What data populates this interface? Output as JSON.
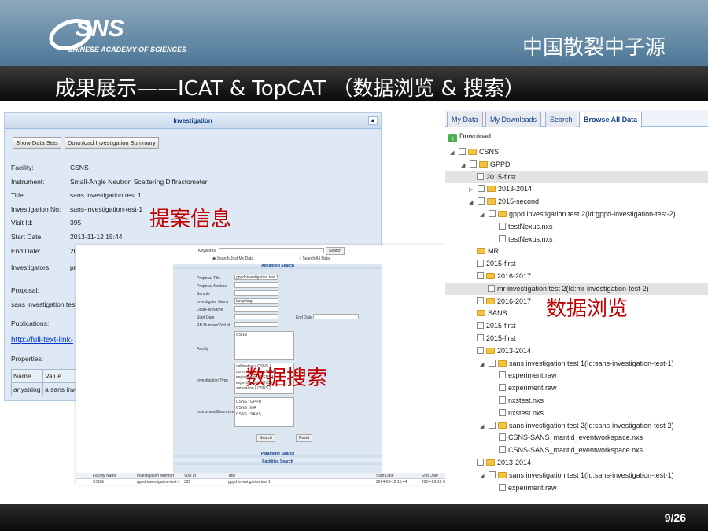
{
  "header": {
    "logo_text": "SNS",
    "logo_sub": "CHINESE ACADEMY OF SCIENCES",
    "org_name": "中国散裂中子源",
    "slide_title": "成果展示——ICAT & TopCAT （数据浏览 & 搜索）"
  },
  "footer": {
    "page": "9/26"
  },
  "labels": {
    "proposal_info": "提案信息",
    "data_search": "数据搜索",
    "data_browse": "数据浏览"
  },
  "investigation": {
    "panel_title": "Investigation",
    "show_data_sets": "Show Data Sets",
    "download_summary": "Download Investigation Summary",
    "fields": [
      {
        "k": "Facility:",
        "v": "CSNS"
      },
      {
        "k": "Instrument:",
        "v": "Small-Angle Neutron Scattering Diffractometer"
      },
      {
        "k": "Title:",
        "v": "sans investigation test 1"
      },
      {
        "k": "Investigation No:",
        "v": "sans-investigation-test-1"
      },
      {
        "k": "Visit Id:",
        "v": "395"
      },
      {
        "k": "Start Date:",
        "v": "2013-11-12 15:44"
      },
      {
        "k": "End Date:",
        "v": "20"
      },
      {
        "k": "Investigators:",
        "v": "pr"
      }
    ],
    "proposal_label": "Proposal:",
    "proposal_value": "sans investigation test",
    "publications_label": "Publications:",
    "publication_link": "http://full-text-link-",
    "properties_label": "Properties:",
    "properties_headers": [
      "Name",
      "Value"
    ],
    "properties_row": [
      "anystring",
      "a sans inve"
    ]
  },
  "search": {
    "keywords_label": "Keywords",
    "search_btn": "Search",
    "radio_my": "Search Just My Data",
    "radio_all": "Search All Data",
    "advanced_title": "Advanced Search",
    "proposal_title_label": "Proposal Title",
    "proposal_title_value": "gppd investigation test 1",
    "proposal_abstract_label": "Proposal Abstract",
    "sample_label": "Sample",
    "investigator_label": "Investigator Name",
    "investigator_value": "tangming",
    "datafile_label": "DataFile Name",
    "start_date_label": "Start Date",
    "end_date_label": "End Date",
    "rb_label": "RB Number/Visit Id",
    "facility_label": "Facility",
    "facility_value": "CSNS",
    "inv_type_label": "Investigation Type",
    "inv_types": [
      "calibration ( CSNS )",
      "commissioning ( CSNS )",
      "engineering ( CSNS )",
      "experiment ( CSNS )",
      "simulation ( CSNS )"
    ],
    "instrument_label": "Instrument/Beam Line",
    "instruments": [
      "CSNS : GPPD",
      "CSNS : MR",
      "CSNS : SANS"
    ],
    "search_btn2": "Search",
    "reset_btn": "Reset",
    "param_title": "Parameter Search",
    "facilities_title": "Facilities Search",
    "results_headers": [
      "Facility Name",
      "Investigation Number",
      "Visit Id",
      "Title",
      "Start Date",
      "End Date"
    ],
    "results_row": [
      "CSNS",
      "gppd-investigation-test-1",
      "395",
      "gppd investigation test 1",
      "2014-03-12 15:44",
      "2014-03-15 00:00"
    ]
  },
  "tree": {
    "tabs": [
      "My Data",
      "My Downloads",
      "Search",
      "Browse All Data"
    ],
    "download": "Download",
    "items": [
      {
        "label": "CSNS",
        "folder": true
      },
      {
        "label": "GPPD",
        "folder": true
      },
      {
        "label": "2015-first",
        "folder": false
      },
      {
        "label": "2013-2014",
        "folder": true
      },
      {
        "label": "2015-second",
        "folder": true
      },
      {
        "label": "gppd investigation test 2(Id:gppd-investigation-test-2)",
        "folder": true
      },
      {
        "label": "testNexus.nxs",
        "folder": false
      },
      {
        "label": "testNexus.nxs",
        "folder": false
      },
      {
        "label": "MR",
        "folder": true
      },
      {
        "label": "2015-first",
        "folder": false
      },
      {
        "label": "2016-2017",
        "folder": true
      },
      {
        "label": "mr investigation test 2(Id:mr-investigation-test-2)",
        "folder": false
      },
      {
        "label": "2016-2017",
        "folder": true
      },
      {
        "label": "SANS",
        "folder": true
      },
      {
        "label": "2015-first",
        "folder": false
      },
      {
        "label": "2015-first",
        "folder": false
      },
      {
        "label": "2013-2014",
        "folder": true
      },
      {
        "label": "sans investigation test 1(Id:sans-investigation-test-1)",
        "folder": true
      },
      {
        "label": "experiment.raw",
        "folder": false
      },
      {
        "label": "experiment.raw",
        "folder": false
      },
      {
        "label": "nxstest.nxs",
        "folder": false
      },
      {
        "label": "nxstest.nxs",
        "folder": false
      },
      {
        "label": "sans investigation test 2(Id:sans-investigation-test-2)",
        "folder": true
      },
      {
        "label": "CSNS-SANS_mantid_eventworkspace.nxs",
        "folder": false
      },
      {
        "label": "CSNS-SANS_mantid_eventworkspace.nxs",
        "folder": false
      },
      {
        "label": "2013-2014",
        "folder": true
      },
      {
        "label": "sans investigation test 1(Id:sans-investigation-test-1)",
        "folder": true
      },
      {
        "label": "experiment.raw",
        "folder": false
      }
    ]
  }
}
